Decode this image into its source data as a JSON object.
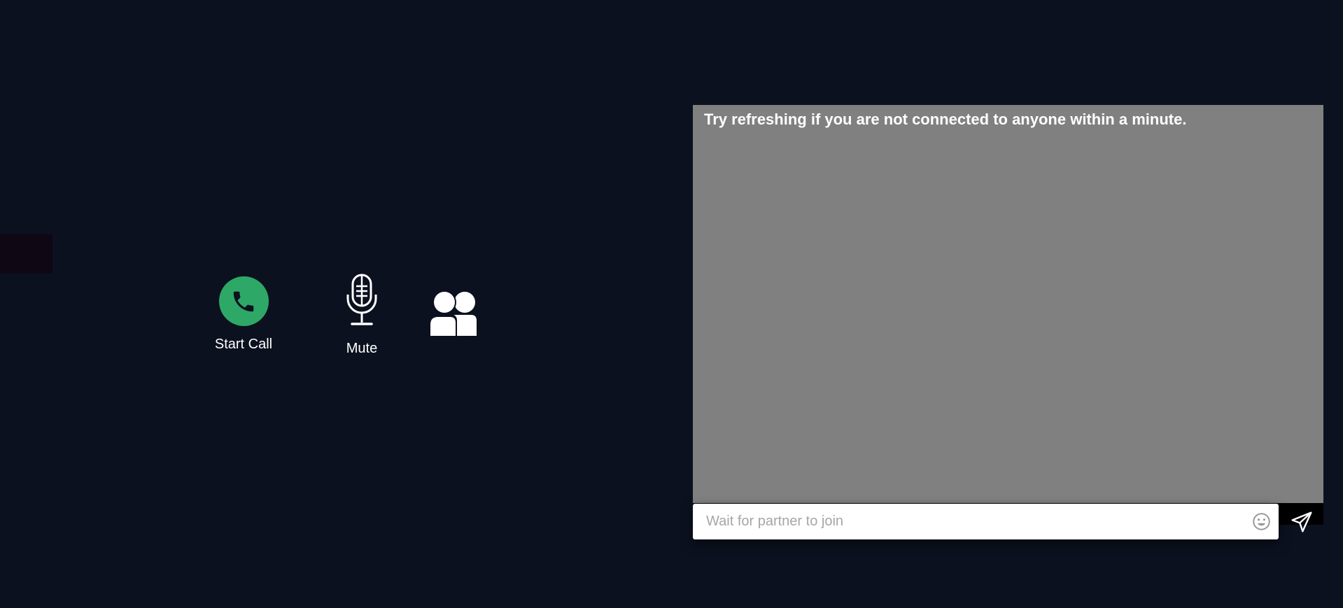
{
  "controls": {
    "start_call_label": "Start Call",
    "mute_label": "Mute"
  },
  "icons": {
    "phone": "phone-icon",
    "microphone": "microphone-icon",
    "users": "users-icon",
    "emoji": "smiley-icon",
    "send": "send-icon"
  },
  "chat": {
    "notice": "Try refreshing if you are not connected to anyone within a minute.",
    "input_placeholder": "Wait for partner to join",
    "input_value": ""
  },
  "colors": {
    "background": "#0b111f",
    "call_button": "#2ea866",
    "chat_panel": "#808080",
    "send_bar": "#000000"
  }
}
